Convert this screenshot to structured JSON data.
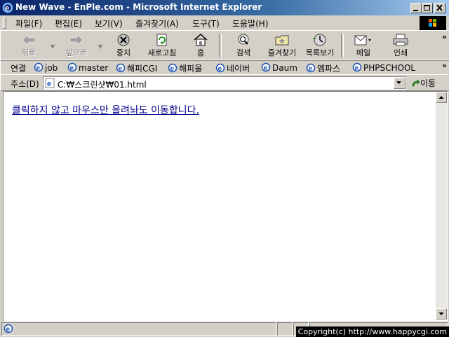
{
  "window": {
    "title": "New Wave - EnPle.com - Microsoft Internet Explorer"
  },
  "menu": [
    "파일(F)",
    "편집(E)",
    "보기(V)",
    "즐겨찾기(A)",
    "도구(T)",
    "도움말(H)"
  ],
  "toolbar": {
    "back": "뒤로",
    "forward": "앞으로",
    "stop": "중지",
    "refresh": "새로고침",
    "home": "홈",
    "search": "검색",
    "favorites": "즐겨찾기",
    "history": "목록보기",
    "mail": "메일",
    "print": "인쇄"
  },
  "links": {
    "label": "연결",
    "items": [
      "job",
      "master",
      "해피CGI",
      "해피몰",
      "네이버",
      "Daum",
      "엠파스",
      "PHPSCHOOL"
    ]
  },
  "address": {
    "label": "주소(D)",
    "value": "C:₩스크린샷₩01.html",
    "go": "이동"
  },
  "content": {
    "link_text": "클릭하지 않고 마우스만 올려놔도 이동합니다."
  },
  "watermark": {
    "text": "Copyright(c) http://www.happycgi.com"
  },
  "colors": {
    "titlebar": "#0a246a",
    "chrome": "#d4d0c8",
    "link": "#00008b"
  }
}
